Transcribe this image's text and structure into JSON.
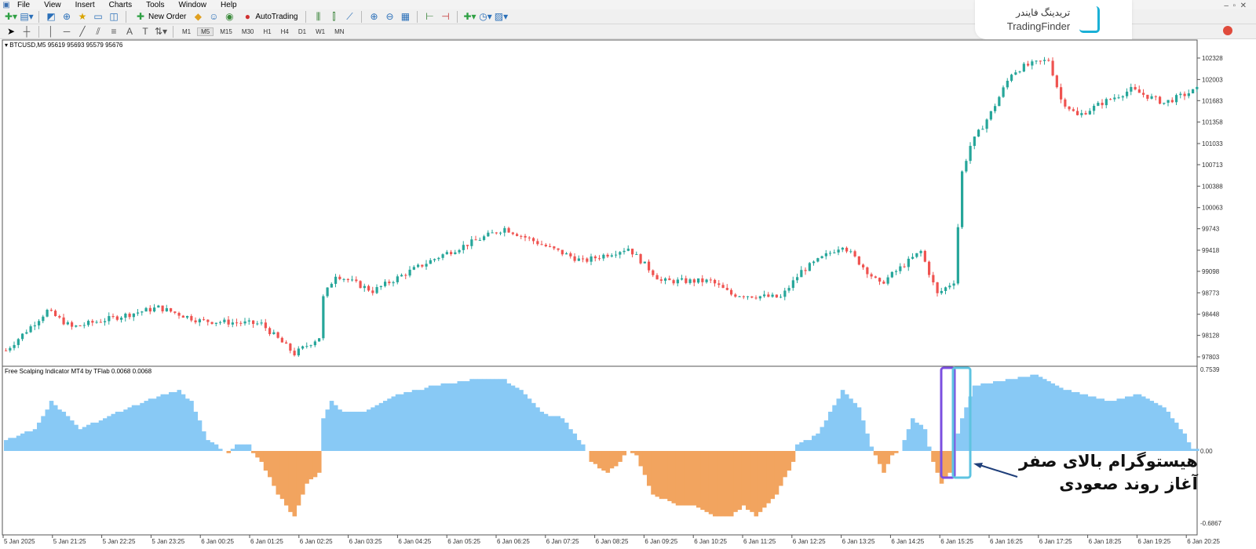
{
  "menu": [
    "File",
    "View",
    "Insert",
    "Charts",
    "Tools",
    "Window",
    "Help"
  ],
  "toolbar": {
    "new_order": "New Order",
    "autotrading": "AutoTrading"
  },
  "timeframes": [
    "M1",
    "M5",
    "M15",
    "M30",
    "H1",
    "H4",
    "D1",
    "W1",
    "MN"
  ],
  "active_timeframe": "M5",
  "symbol_info": "BTCUSD,M5  95619 95693 95579 95676",
  "indicator_title": "Free Scalping Indicator MT4 by TFlab 0.0068 0.0068",
  "logo": {
    "fa": "تریدینگ فایندر",
    "en": "TradingFinder"
  },
  "annotation": {
    "line1": "هیستوگرام بالای صفر",
    "line2": "آغاز روند صعودی"
  },
  "price_axis": [
    "102328",
    "102003",
    "101683",
    "101358",
    "101033",
    "100713",
    "100388",
    "100063",
    "99743",
    "99418",
    "99098",
    "98773",
    "98448",
    "98128",
    "97803"
  ],
  "indicator_axis": [
    "0.7539",
    "0.00",
    "-0.6867"
  ],
  "time_axis": [
    "5 Jan 2025",
    "5 Jan 21:25",
    "5 Jan 22:25",
    "5 Jan 23:25",
    "6 Jan 00:25",
    "6 Jan 01:25",
    "6 Jan 02:25",
    "6 Jan 03:25",
    "6 Jan 04:25",
    "6 Jan 05:25",
    "6 Jan 06:25",
    "6 Jan 07:25",
    "6 Jan 08:25",
    "6 Jan 09:25",
    "6 Jan 10:25",
    "6 Jan 11:25",
    "6 Jan 12:25",
    "6 Jan 13:25",
    "6 Jan 14:25",
    "6 Jan 15:25",
    "6 Jan 16:25",
    "6 Jan 17:25",
    "6 Jan 18:25",
    "6 Jan 19:25",
    "6 Jan 20:25"
  ],
  "colors": {
    "bull": "#26a69a",
    "bear": "#ef5350",
    "hist_pos": "#88c9f5",
    "hist_neg": "#f2a45f",
    "highlight": "#7b4fe0",
    "arrow": "#1f3f7a"
  },
  "price_path": [
    [
      0,
      97900
    ],
    [
      10,
      98500
    ],
    [
      16,
      98250
    ],
    [
      37,
      98550
    ],
    [
      47,
      98350
    ],
    [
      62,
      98300
    ],
    [
      70,
      97850
    ],
    [
      76,
      98100
    ],
    [
      77,
      98700
    ],
    [
      80,
      99050
    ],
    [
      89,
      98800
    ],
    [
      98,
      99100
    ],
    [
      106,
      99350
    ],
    [
      121,
      99750
    ],
    [
      132,
      99450
    ],
    [
      140,
      99250
    ],
    [
      151,
      99450
    ],
    [
      159,
      98950
    ],
    [
      171,
      98950
    ],
    [
      176,
      98750
    ],
    [
      188,
      98700
    ],
    [
      193,
      99100
    ],
    [
      203,
      99500
    ],
    [
      212,
      98900
    ],
    [
      222,
      99400
    ],
    [
      226,
      98750
    ],
    [
      230,
      98950
    ],
    [
      232,
      100600
    ],
    [
      234,
      101000
    ],
    [
      239,
      101500
    ],
    [
      244,
      102100
    ],
    [
      247,
      102200
    ],
    [
      253,
      102300
    ],
    [
      256,
      101700
    ],
    [
      260,
      101450
    ],
    [
      266,
      101650
    ],
    [
      273,
      101850
    ],
    [
      281,
      101650
    ],
    [
      289,
      101850
    ]
  ],
  "histogram_path": [
    [
      0,
      0.1
    ],
    [
      7,
      0.2
    ],
    [
      11,
      0.45
    ],
    [
      14,
      0.35
    ],
    [
      18,
      0.2
    ],
    [
      24,
      0.3
    ],
    [
      30,
      0.4
    ],
    [
      37,
      0.5
    ],
    [
      42,
      0.55
    ],
    [
      45,
      0.45
    ],
    [
      49,
      0.1
    ],
    [
      53,
      0.0
    ],
    [
      54,
      -0.03
    ],
    [
      56,
      0.05
    ],
    [
      59,
      0.05
    ],
    [
      60,
      -0.02
    ],
    [
      62,
      -0.1
    ],
    [
      66,
      -0.4
    ],
    [
      70,
      -0.6
    ],
    [
      73,
      -0.3
    ],
    [
      76,
      -0.2
    ],
    [
      77,
      0.3
    ],
    [
      79,
      0.45
    ],
    [
      82,
      0.35
    ],
    [
      87,
      0.35
    ],
    [
      94,
      0.5
    ],
    [
      104,
      0.6
    ],
    [
      113,
      0.65
    ],
    [
      121,
      0.65
    ],
    [
      125,
      0.55
    ],
    [
      130,
      0.35
    ],
    [
      135,
      0.3
    ],
    [
      138,
      0.15
    ],
    [
      141,
      0.0
    ],
    [
      142,
      -0.1
    ],
    [
      146,
      -0.2
    ],
    [
      149,
      -0.1
    ],
    [
      151,
      0.0
    ],
    [
      153,
      -0.05
    ],
    [
      157,
      -0.4
    ],
    [
      163,
      -0.5
    ],
    [
      167,
      -0.5
    ],
    [
      172,
      -0.6
    ],
    [
      176,
      -0.6
    ],
    [
      179,
      -0.5
    ],
    [
      182,
      -0.6
    ],
    [
      187,
      -0.4
    ],
    [
      191,
      -0.1
    ],
    [
      192,
      0.05
    ],
    [
      197,
      0.15
    ],
    [
      203,
      0.55
    ],
    [
      207,
      0.4
    ],
    [
      210,
      0.05
    ],
    [
      211,
      -0.05
    ],
    [
      213,
      -0.2
    ],
    [
      215,
      -0.05
    ],
    [
      217,
      0.0
    ],
    [
      220,
      0.3
    ],
    [
      223,
      0.2
    ],
    [
      225,
      -0.1
    ],
    [
      227,
      -0.3
    ],
    [
      229,
      -0.2
    ],
    [
      230,
      0.0
    ],
    [
      232,
      0.3
    ],
    [
      235,
      0.6
    ],
    [
      243,
      0.65
    ],
    [
      250,
      0.7
    ],
    [
      258,
      0.55
    ],
    [
      268,
      0.45
    ],
    [
      275,
      0.52
    ],
    [
      281,
      0.4
    ],
    [
      286,
      0.15
    ],
    [
      288,
      0.02
    ]
  ]
}
